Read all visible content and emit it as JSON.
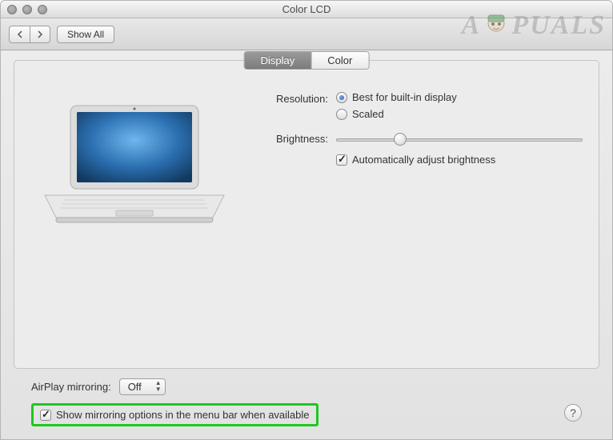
{
  "window": {
    "title": "Color LCD"
  },
  "toolbar": {
    "show_all": "Show All"
  },
  "watermark": {
    "prefix": "A",
    "suffix": "PUALS"
  },
  "tabs": {
    "display": "Display",
    "color": "Color"
  },
  "resolution": {
    "label": "Resolution:",
    "best": "Best for built-in display",
    "scaled": "Scaled"
  },
  "brightness": {
    "label": "Brightness:",
    "auto": "Automatically adjust brightness",
    "value": 26
  },
  "airplay": {
    "label": "AirPlay mirroring:",
    "selected": "Off"
  },
  "mirroring_checkbox": "Show mirroring options in the menu bar when available",
  "help": "?"
}
